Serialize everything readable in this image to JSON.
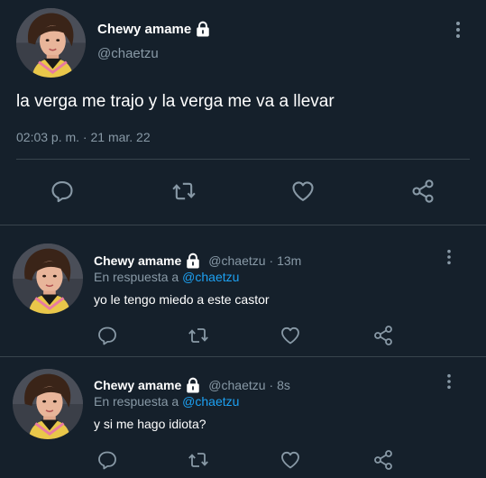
{
  "main_tweet": {
    "display_name": "Chewy amame",
    "handle": "@chaetzu",
    "text": "la verga me trajo y la verga me va a llevar",
    "timestamp": "02:03 p. m. · 21 mar. 22",
    "icons": [
      "lock-icon",
      "more-icon",
      "reply-icon",
      "retweet-icon",
      "like-icon",
      "share-icon"
    ]
  },
  "replies": [
    {
      "display_name": "Chewy amame",
      "handle": "@chaetzu",
      "time": "· 13m",
      "in_reply_prefix": "En respuesta a",
      "in_reply_handle": "@chaetzu",
      "text": "yo le tengo miedo a este castor"
    },
    {
      "display_name": "Chewy amame",
      "handle": "@chaetzu",
      "time": "· 8s",
      "in_reply_prefix": "En respuesta a",
      "in_reply_handle": "@chaetzu",
      "text": "y si me hago idiota?"
    }
  ],
  "colors": {
    "background": "#15202b",
    "text": "#ffffff",
    "secondary": "#8899a6",
    "accent": "#1da1f2",
    "divider": "#38444d"
  }
}
